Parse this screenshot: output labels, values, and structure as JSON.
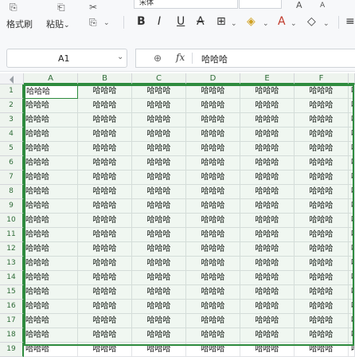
{
  "toolbar": {
    "cell_style_label": "格式刷",
    "paste_label": "粘贴",
    "font_name": "宋体",
    "bold": "B",
    "italic": "I",
    "underline": "U",
    "strikethrough": "A"
  },
  "formula_bar": {
    "cell_ref": "A1",
    "fx_label": "fx",
    "value": "哈哈哈"
  },
  "columns": [
    "A",
    "B",
    "C",
    "D",
    "E",
    "F"
  ],
  "rows": [
    "1",
    "2",
    "3",
    "4",
    "5",
    "6",
    "7",
    "8",
    "9",
    "10",
    "11",
    "12",
    "13",
    "14",
    "15",
    "16",
    "17",
    "18",
    "19"
  ],
  "cell_text": "哈哈哈",
  "partial_cell_text": "哈",
  "colors": {
    "selection_green": "#2e8b3e",
    "header_bg": "#eef4ee"
  }
}
